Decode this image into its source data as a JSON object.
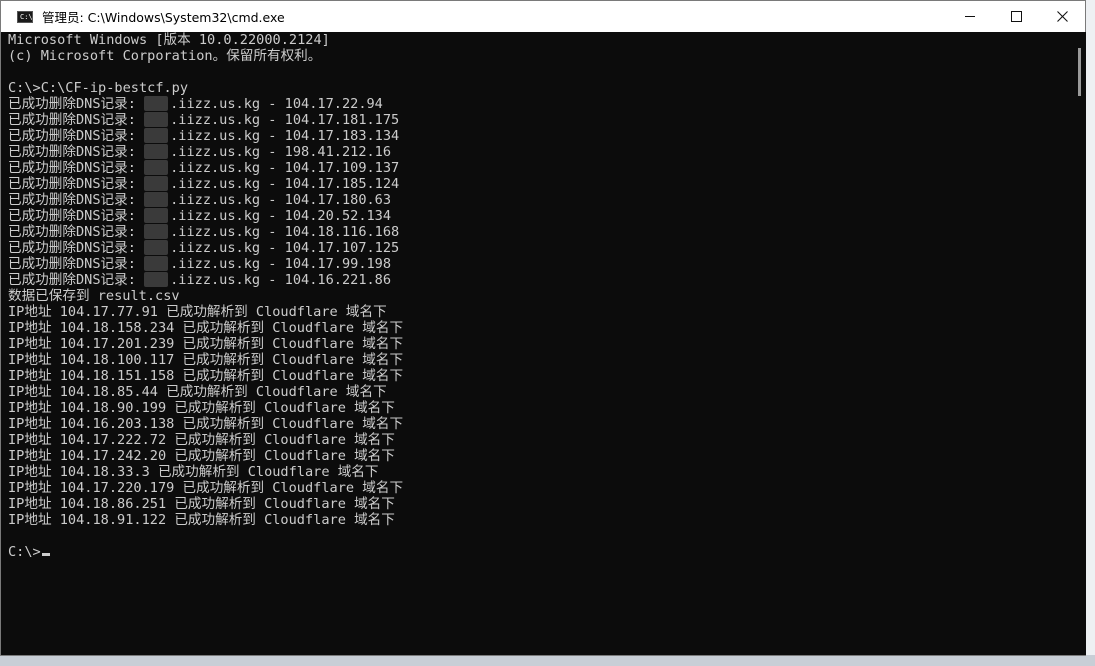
{
  "window": {
    "title": "管理员: C:\\Windows\\System32\\cmd.exe",
    "icon": "cmd-icon",
    "icon_text": "C:\\"
  },
  "console": {
    "lines": [
      "Microsoft Windows [版本 10.0.22000.2124]",
      "(c) Microsoft Corporation。保留所有权利。",
      "",
      "C:\\>C:\\CF-ip-bestcf.py",
      "已成功删除DNS记录: ▒.iizz.us.kg - 104.17.22.94",
      "已成功删除DNS记录: ▒.iizz.us.kg - 104.17.181.175",
      "已成功删除DNS记录: ▒.iizz.us.kg - 104.17.183.134",
      "已成功删除DNS记录: ▒.iizz.us.kg - 198.41.212.16",
      "已成功删除DNS记录: ▒.iizz.us.kg - 104.17.109.137",
      "已成功删除DNS记录: ▒.iizz.us.kg - 104.17.185.124",
      "已成功删除DNS记录: ▒.iizz.us.kg - 104.17.180.63",
      "已成功删除DNS记录: ▒.iizz.us.kg - 104.20.52.134",
      "已成功删除DNS记录: ▒.iizz.us.kg - 104.18.116.168",
      "已成功删除DNS记录: ▒.iizz.us.kg - 104.17.107.125",
      "已成功删除DNS记录: ▒.iizz.us.kg - 104.17.99.198",
      "已成功删除DNS记录: ▒.iizz.us.kg - 104.16.221.86",
      "数据已保存到 result.csv",
      "IP地址 104.17.77.91 已成功解析到 Cloudflare 域名下",
      "IP地址 104.18.158.234 已成功解析到 Cloudflare 域名下",
      "IP地址 104.17.201.239 已成功解析到 Cloudflare 域名下",
      "IP地址 104.18.100.117 已成功解析到 Cloudflare 域名下",
      "IP地址 104.18.151.158 已成功解析到 Cloudflare 域名下",
      "IP地址 104.18.85.44 已成功解析到 Cloudflare 域名下",
      "IP地址 104.18.90.199 已成功解析到 Cloudflare 域名下",
      "IP地址 104.16.203.138 已成功解析到 Cloudflare 域名下",
      "IP地址 104.17.222.72 已成功解析到 Cloudflare 域名下",
      "IP地址 104.17.242.20 已成功解析到 Cloudflare 域名下",
      "IP地址 104.18.33.3 已成功解析到 Cloudflare 域名下",
      "IP地址 104.17.220.179 已成功解析到 Cloudflare 域名下",
      "IP地址 104.18.86.251 已成功解析到 Cloudflare 域名下",
      "IP地址 104.18.91.122 已成功解析到 Cloudflare 域名下",
      "",
      "C:\\>"
    ]
  },
  "colors": {
    "console_bg": "#0c0c0c",
    "console_fg": "#cccccc",
    "titlebar_bg": "#ffffff"
  }
}
